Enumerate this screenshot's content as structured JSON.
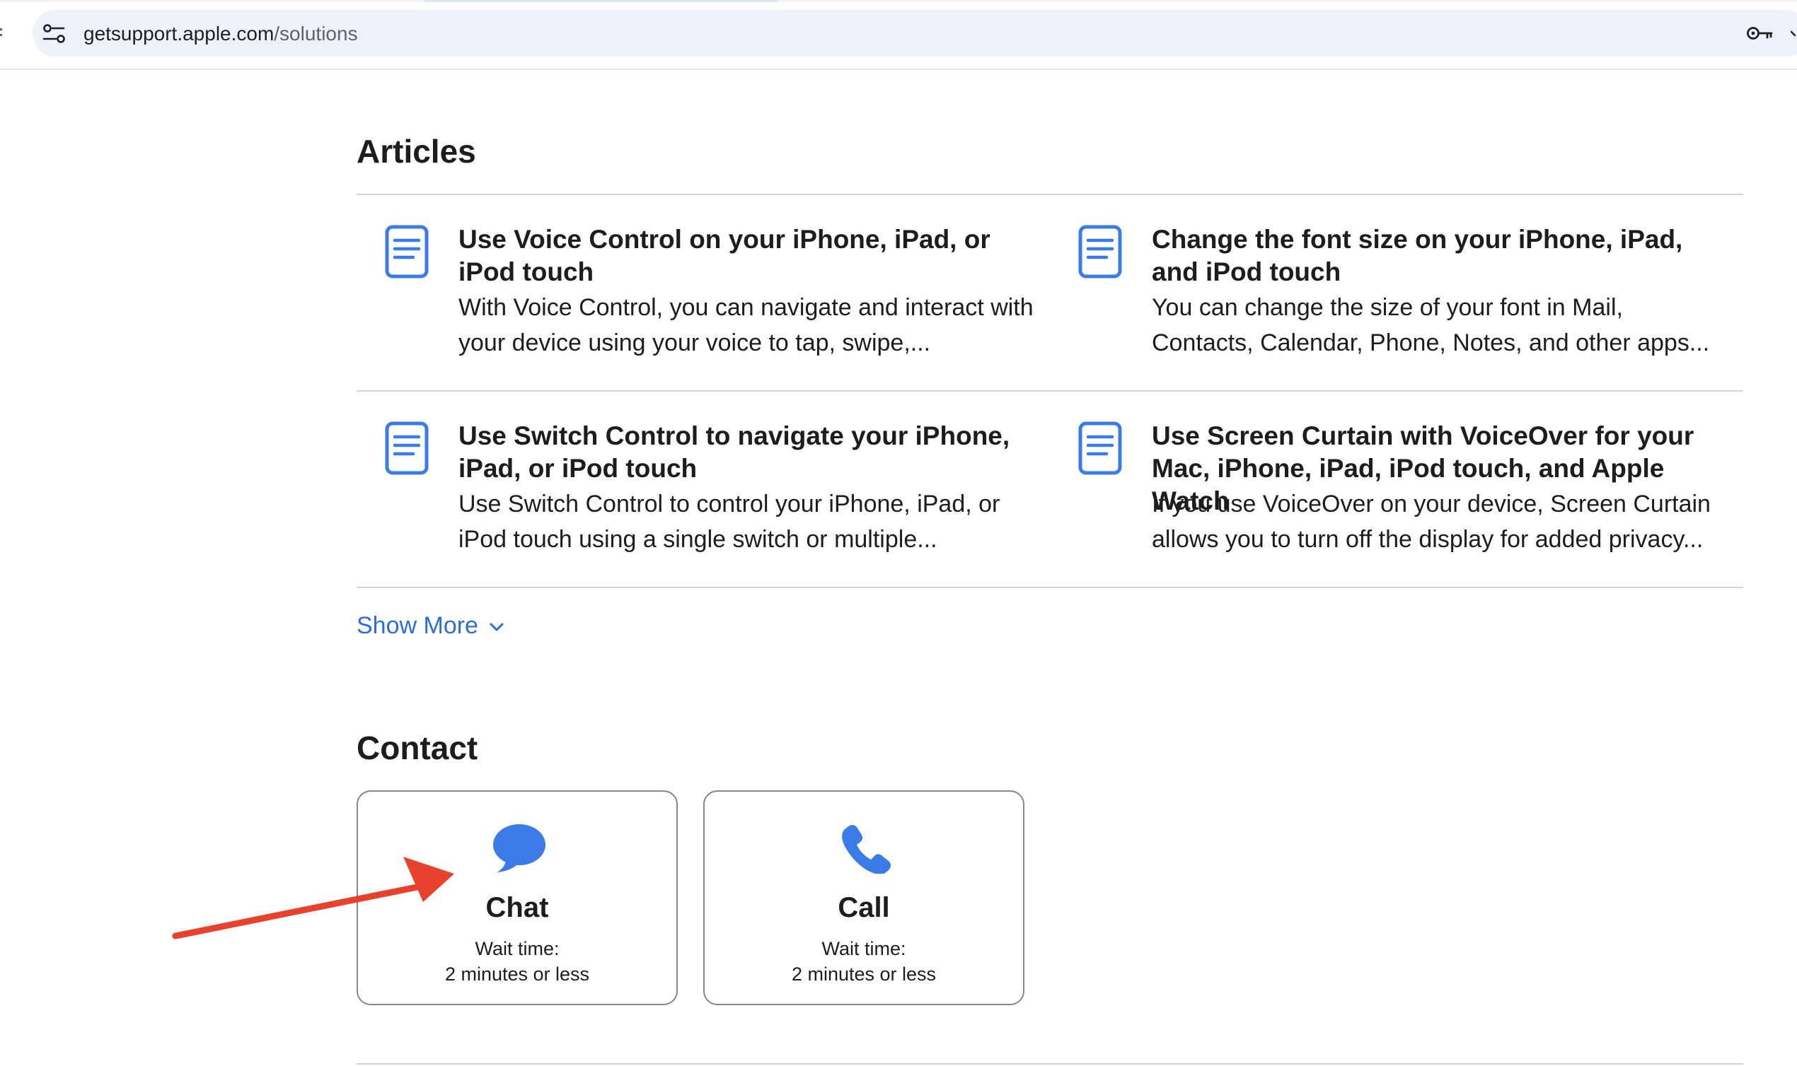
{
  "browser": {
    "url_host": "getsupport.apple.com",
    "url_path": "/solutions",
    "icons": {
      "site_settings": "tune-icon",
      "password_manager": "key-icon"
    }
  },
  "articles": {
    "heading": "Articles",
    "items": [
      {
        "title": "Use Voice Control on your iPhone, iPad, or iPod touch",
        "description": "With Voice Control, you can navigate and interact with your device using your voice to tap, swipe,..."
      },
      {
        "title": "Change the font size on your iPhone, iPad, and iPod touch",
        "description": "You can change the size of your font in Mail, Contacts, Calendar, Phone, Notes, and other apps..."
      },
      {
        "title": "Use Switch Control to navigate your iPhone, iPad, or iPod touch",
        "description": "Use Switch Control to control your iPhone, iPad, or iPod touch using a single switch or multiple..."
      },
      {
        "title": "Use Screen Curtain with VoiceOver for your Mac, iPhone, iPad, iPod touch, and Apple Watch",
        "description": "If you use VoiceOver on your device, Screen Curtain allows you to turn off the display for added privacy..."
      }
    ],
    "show_more_label": "Show More"
  },
  "contact": {
    "heading": "Contact",
    "options": [
      {
        "label": "Chat",
        "wait_label": "Wait time:",
        "wait_value": "2 minutes or less",
        "icon": "chat-bubble-icon"
      },
      {
        "label": "Call",
        "wait_label": "Wait time:",
        "wait_value": "2 minutes or less",
        "icon": "phone-icon"
      }
    ]
  },
  "colors": {
    "accent_blue": "#3b7be8",
    "link_blue": "#2b6fd6",
    "annotation_red": "#e8412c",
    "divider": "#d2d2d7"
  },
  "annotation": {
    "type": "arrow",
    "points_to": "chat-button"
  }
}
